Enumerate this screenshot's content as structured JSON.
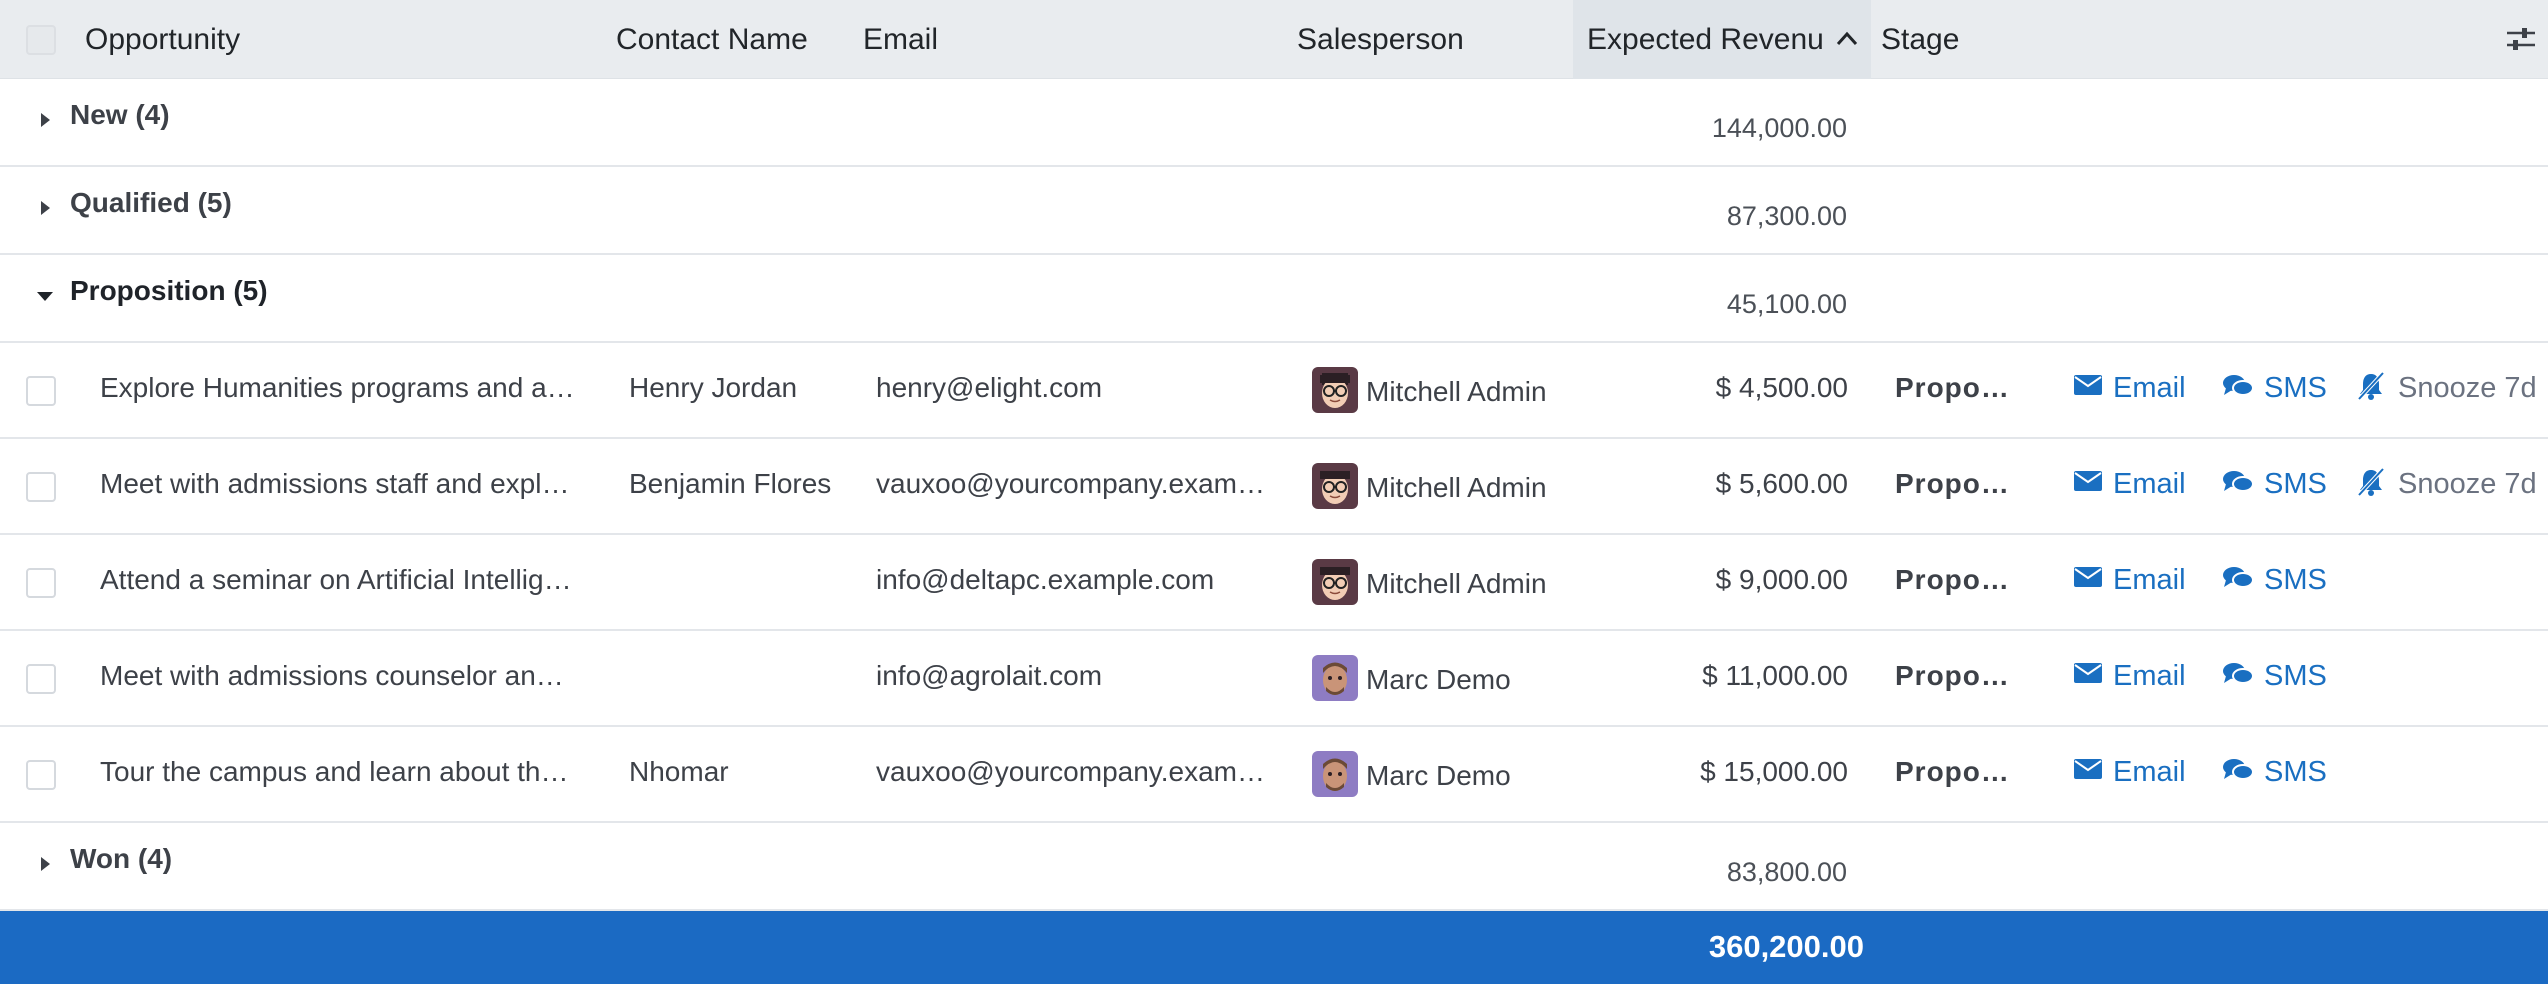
{
  "colors": {
    "header_bg": "#e9ecef",
    "link": "#1a6fc1",
    "footer_bg": "#1b6ac3"
  },
  "columns": {
    "opportunity": "Opportunity",
    "contact": "Contact Name",
    "email": "Email",
    "salesperson": "Salesperson",
    "revenue": "Expected Revenu",
    "stage": "Stage"
  },
  "groups": [
    {
      "label": "New (4)",
      "sum": "144,000.00",
      "expanded": false
    },
    {
      "label": "Qualified (5)",
      "sum": "87,300.00",
      "expanded": false
    },
    {
      "label": "Proposition (5)",
      "sum": "45,100.00",
      "expanded": true
    },
    {
      "label": "Won (4)",
      "sum": "83,800.00",
      "expanded": false
    }
  ],
  "rows": [
    {
      "opportunity": "Explore Humanities programs and att…",
      "contact": "Henry Jordan",
      "email": "henry@elight.com",
      "salesperson": "Mitchell Admin",
      "avatar": "mitchell-avatar",
      "revenue": "$ 4,500.00",
      "stage": "Proposi…",
      "email_action": "Email",
      "sms_action": "SMS",
      "snooze_action": "Snooze 7d"
    },
    {
      "opportunity": "Meet with admissions staff and explor…",
      "contact": "Benjamin Flores",
      "email": "vauxoo@yourcompany.exampl…",
      "salesperson": "Mitchell Admin",
      "avatar": "mitchell-avatar",
      "revenue": "$ 5,600.00",
      "stage": "Proposi…",
      "email_action": "Email",
      "sms_action": "SMS",
      "snooze_action": "Snooze 7d"
    },
    {
      "opportunity": "Attend a seminar on Artificial Intellige…",
      "contact": "",
      "email": "info@deltapc.example.com",
      "salesperson": "Mitchell Admin",
      "avatar": "mitchell-avatar",
      "revenue": "$ 9,000.00",
      "stage": "Proposi…",
      "email_action": "Email",
      "sms_action": "SMS"
    },
    {
      "opportunity": "Meet with admissions counselor and t…",
      "contact": "",
      "email": "info@agrolait.com",
      "salesperson": "Marc Demo",
      "avatar": "marc-avatar",
      "revenue": "$ 11,000.00",
      "stage": "Proposi…",
      "email_action": "Email",
      "sms_action": "SMS"
    },
    {
      "opportunity": "Tour the campus and learn about the …",
      "contact": "Nhomar",
      "email": "vauxoo@yourcompany.exampl…",
      "salesperson": "Marc Demo",
      "avatar": "marc-avatar",
      "revenue": "$ 15,000.00",
      "stage": "Proposi…",
      "email_action": "Email",
      "sms_action": "SMS"
    }
  ],
  "total": "360,200.00"
}
